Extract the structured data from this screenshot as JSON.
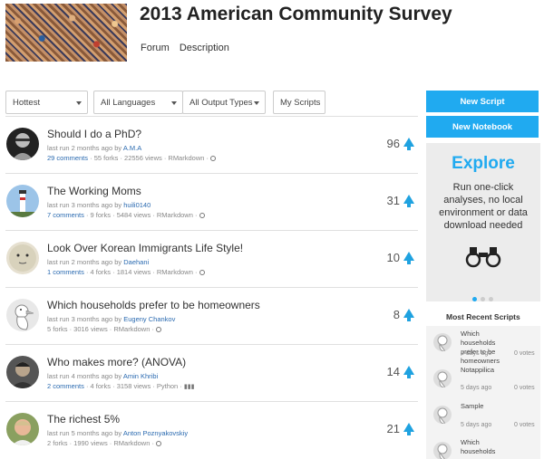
{
  "page": {
    "title": "2013 American Community Survey"
  },
  "nav": {
    "forum": "Forum",
    "description": "Description"
  },
  "filters": {
    "sort": "Hottest",
    "languages": "All Languages",
    "output": "All Output Types",
    "my_scripts": "My Scripts"
  },
  "scripts": [
    {
      "title": "Should I do a PhD?",
      "ago": "last run 2 months ago by",
      "author": "A.M.A",
      "comments": "29 comments",
      "rest": " · 55 forks · 22556 views · RMarkdown · ",
      "votes": "96",
      "avatar": "bw-man"
    },
    {
      "title": "The Working Moms",
      "ago": "last run 3 months ago by",
      "author": "huili0140",
      "comments": "7 comments",
      "rest": " · 9 forks · 5484 views · RMarkdown · ",
      "votes": "31",
      "avatar": "lighthouse"
    },
    {
      "title": "Look Over Korean Immigrants Life Style!",
      "ago": "last run 2 months ago by",
      "author": "Daehani",
      "comments": "1 comments",
      "rest": " · 4 forks · 1814 views · RMarkdown · ",
      "votes": "10",
      "avatar": "face"
    },
    {
      "title": "Which households prefer to be homeowners",
      "ago": "last run 3 months ago by",
      "author": "Eugeny Chankov",
      "comments": "",
      "rest": "5 forks · 3016 views · RMarkdown · ",
      "votes": "8",
      "avatar": "duck"
    },
    {
      "title": "Who makes more? (ANOVA)",
      "ago": "last run 4 months ago by",
      "author": "Amin Khribi",
      "comments": "2 comments",
      "rest": " · 4 forks · 3158 views · Python · ",
      "votes": "14",
      "avatar": "person-dark"
    },
    {
      "title": "The richest 5%",
      "ago": "last run 5 months ago by",
      "author": "Anton Poznyakovskiy",
      "comments": "",
      "rest": "2 forks · 1990 views · RMarkdown · ",
      "votes": "21",
      "avatar": "person-light"
    }
  ],
  "sidebar": {
    "new_script": "New Script",
    "new_notebook": "New Notebook",
    "explore_title": "Explore",
    "explore_text": "Run one-click analyses, no local environment or data download needed",
    "recent_title": "Most Recent Scripts",
    "recent": [
      {
        "name": "Which households prefer to be homeowners",
        "ago": "5 days ago",
        "votes": "0 votes"
      },
      {
        "name": "Notappilica",
        "ago": "5 days ago",
        "votes": "0 votes"
      },
      {
        "name": "Sample",
        "ago": "5 days ago",
        "votes": "0 votes"
      },
      {
        "name": "Which households",
        "ago": "",
        "votes": ""
      }
    ]
  },
  "colors": {
    "accent": "#20aaf0",
    "link": "#2a6ab0"
  }
}
